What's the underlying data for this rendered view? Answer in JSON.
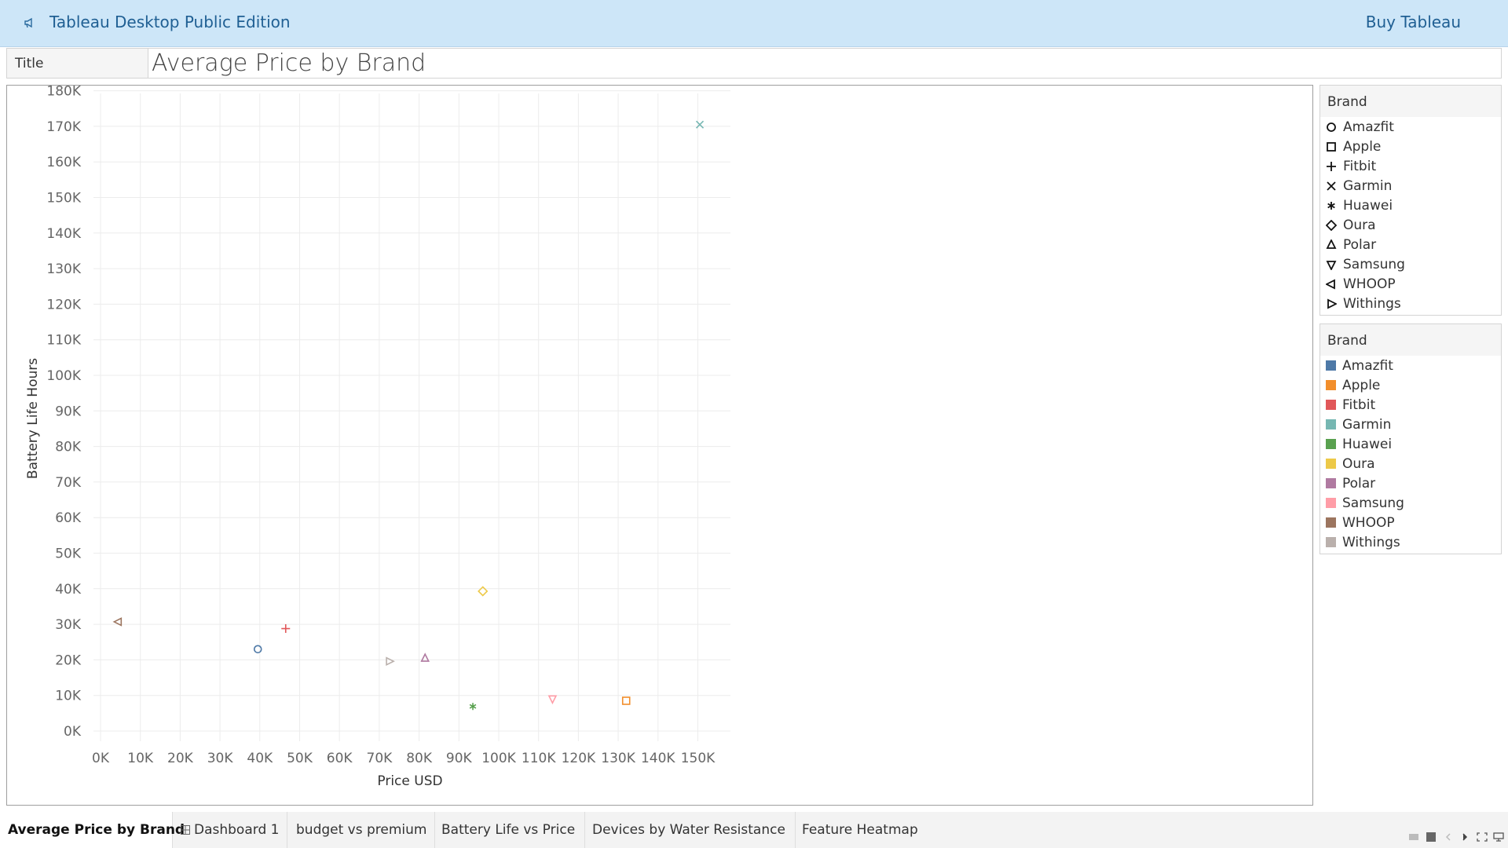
{
  "header": {
    "app_title": "Tableau Desktop Public Edition",
    "buy_label": "Buy Tableau",
    "logo_icon": "megaphone-icon"
  },
  "title_bar": {
    "label": "Title",
    "value": "Average Price by Brand"
  },
  "chart_data": {
    "type": "scatter",
    "xlabel": "Price USD",
    "ylabel": "Battery Life Hours",
    "xlim": [
      0,
      160000
    ],
    "ylim": [
      0,
      183000
    ],
    "x_ticks": [
      0,
      10000,
      20000,
      30000,
      40000,
      50000,
      60000,
      70000,
      80000,
      90000,
      100000,
      110000,
      120000,
      130000,
      140000,
      150000
    ],
    "x_tick_labels": [
      "0K",
      "10K",
      "20K",
      "30K",
      "40K",
      "50K",
      "60K",
      "70K",
      "80K",
      "90K",
      "100K",
      "110K",
      "120K",
      "130K",
      "140K",
      "150K"
    ],
    "y_ticks": [
      0,
      10000,
      20000,
      30000,
      40000,
      50000,
      60000,
      70000,
      80000,
      90000,
      100000,
      110000,
      120000,
      130000,
      140000,
      150000,
      160000,
      170000,
      180000
    ],
    "y_tick_labels": [
      "0K",
      "10K",
      "20K",
      "30K",
      "40K",
      "50K",
      "60K",
      "70K",
      "80K",
      "90K",
      "100K",
      "110K",
      "120K",
      "130K",
      "140K",
      "150K",
      "160K",
      "170K",
      "180K"
    ],
    "grid": true,
    "points": [
      {
        "brand": "Amazfit",
        "x": 39500,
        "y": 23000,
        "shape": "circle",
        "color": "#4e79a7"
      },
      {
        "brand": "Apple",
        "x": 132000,
        "y": 8500,
        "shape": "square",
        "color": "#f28e2b"
      },
      {
        "brand": "Fitbit",
        "x": 46500,
        "y": 28800,
        "shape": "plus",
        "color": "#e15759"
      },
      {
        "brand": "Garmin",
        "x": 150500,
        "y": 170500,
        "shape": "cross",
        "color": "#76b7b2"
      },
      {
        "brand": "Huawei",
        "x": 93500,
        "y": 6900,
        "shape": "asterisk",
        "color": "#59a14f"
      },
      {
        "brand": "Oura",
        "x": 96000,
        "y": 39300,
        "shape": "diamond",
        "color": "#edc948"
      },
      {
        "brand": "Polar",
        "x": 81500,
        "y": 20400,
        "shape": "triangle-up",
        "color": "#b07aa1"
      },
      {
        "brand": "Samsung",
        "x": 113500,
        "y": 9100,
        "shape": "triangle-down",
        "color": "#ff9da7"
      },
      {
        "brand": "WHOOP",
        "x": 4500,
        "y": 30700,
        "shape": "triangle-left",
        "color": "#9c755f"
      },
      {
        "brand": "Withings",
        "x": 72500,
        "y": 19600,
        "shape": "triangle-right",
        "color": "#bab0ac"
      }
    ]
  },
  "shape_legend": {
    "title": "Brand",
    "items": [
      {
        "label": "Amazfit",
        "shape": "circle"
      },
      {
        "label": "Apple",
        "shape": "square"
      },
      {
        "label": "Fitbit",
        "shape": "plus"
      },
      {
        "label": "Garmin",
        "shape": "cross"
      },
      {
        "label": "Huawei",
        "shape": "asterisk"
      },
      {
        "label": "Oura",
        "shape": "diamond"
      },
      {
        "label": "Polar",
        "shape": "triangle-up"
      },
      {
        "label": "Samsung",
        "shape": "triangle-down"
      },
      {
        "label": "WHOOP",
        "shape": "triangle-left"
      },
      {
        "label": "Withings",
        "shape": "triangle-right"
      }
    ]
  },
  "color_legend": {
    "title": "Brand",
    "items": [
      {
        "label": "Amazfit",
        "color": "#4e79a7"
      },
      {
        "label": "Apple",
        "color": "#f28e2b"
      },
      {
        "label": "Fitbit",
        "color": "#e15759"
      },
      {
        "label": "Garmin",
        "color": "#76b7b2"
      },
      {
        "label": "Huawei",
        "color": "#59a14f"
      },
      {
        "label": "Oura",
        "color": "#edc948"
      },
      {
        "label": "Polar",
        "color": "#b07aa1"
      },
      {
        "label": "Samsung",
        "color": "#ff9da7"
      },
      {
        "label": "WHOOP",
        "color": "#9c755f"
      },
      {
        "label": "Withings",
        "color": "#bab0ac"
      }
    ]
  },
  "tabs": [
    {
      "label": "Average Price by Brand",
      "active": true
    },
    {
      "label": "Dashboard 1",
      "active": false,
      "icon": "dashboard-grid-icon"
    },
    {
      "label": "budget vs premium",
      "active": false
    },
    {
      "label": "Battery Life vs Price",
      "active": false
    },
    {
      "label": "Devices by Water Resistance",
      "active": false
    },
    {
      "label": "Feature Heatmap",
      "active": false
    }
  ],
  "bottom_controls": [
    {
      "name": "show-filmstrip-icon"
    },
    {
      "name": "show-sheet-icon"
    },
    {
      "name": "prev-sheet-icon"
    },
    {
      "name": "next-sheet-icon"
    },
    {
      "name": "fit-view-icon"
    },
    {
      "name": "presentation-mode-icon"
    }
  ]
}
